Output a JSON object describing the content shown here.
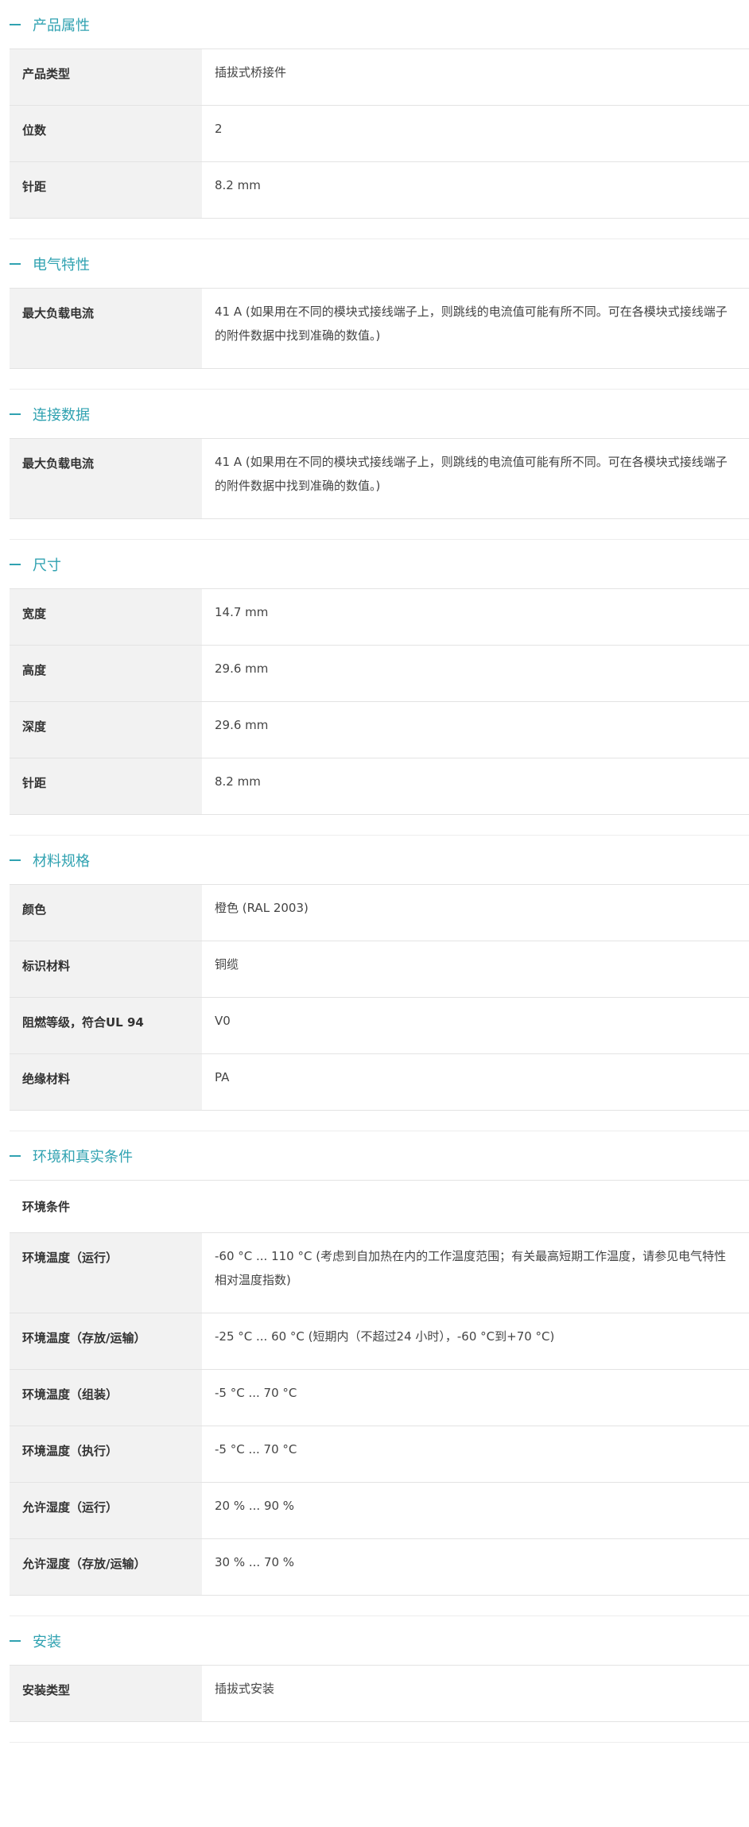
{
  "colors": {
    "accent": "#30a2b1",
    "key_background": "#f2f2f2",
    "border": "#e3e3e3"
  },
  "sections": [
    {
      "title": "产品属性",
      "rows": [
        {
          "key": "产品类型",
          "value": "插拔式桥接件"
        },
        {
          "key": "位数",
          "value": "2"
        },
        {
          "key": "针距",
          "value": "8.2 mm"
        }
      ]
    },
    {
      "title": "电气特性",
      "rows": [
        {
          "key": "最大负载电流",
          "value": "41 A (如果用在不同的模块式接线端子上，则跳线的电流值可能有所不同。可在各模块式接线端子的附件数据中找到准确的数值。)"
        }
      ]
    },
    {
      "title": "连接数据",
      "rows": [
        {
          "key": "最大负载电流",
          "value": "41 A (如果用在不同的模块式接线端子上，则跳线的电流值可能有所不同。可在各模块式接线端子的附件数据中找到准确的数值。)"
        }
      ]
    },
    {
      "title": "尺寸",
      "rows": [
        {
          "key": "宽度",
          "value": "14.7 mm"
        },
        {
          "key": "高度",
          "value": "29.6 mm"
        },
        {
          "key": "深度",
          "value": "29.6 mm"
        },
        {
          "key": "针距",
          "value": "8.2 mm"
        }
      ]
    },
    {
      "title": "材料规格",
      "rows": [
        {
          "key": "颜色",
          "value": "橙色 (RAL 2003)"
        },
        {
          "key": "标识材料",
          "value": "铜缆"
        },
        {
          "key": "阻燃等级，符合UL 94",
          "value": "V0"
        },
        {
          "key": "绝缘材料",
          "value": "PA"
        }
      ]
    },
    {
      "title": "环境和真实条件",
      "subheading": "环境条件",
      "rows": [
        {
          "key": "环境温度（运行）",
          "value": "-60 °C ... 110 °C (考虑到自加热在内的工作温度范围；有关最高短期工作温度，请参见电气特性相对温度指数)"
        },
        {
          "key": "环境温度（存放/运输）",
          "value": "-25 °C ... 60 °C (短期内（不超过24  小时），-60 °C到+70 °C)"
        },
        {
          "key": "环境温度（组装）",
          "value": "-5 °C ... 70 °C"
        },
        {
          "key": "环境温度（执行）",
          "value": "-5 °C ... 70 °C"
        },
        {
          "key": "允许湿度（运行）",
          "value": "20 % ... 90 %"
        },
        {
          "key": "允许湿度（存放/运输）",
          "value": "30 % ... 70 %"
        }
      ]
    },
    {
      "title": "安装",
      "rows": [
        {
          "key": "安装类型",
          "value": "插拔式安装"
        }
      ]
    }
  ]
}
